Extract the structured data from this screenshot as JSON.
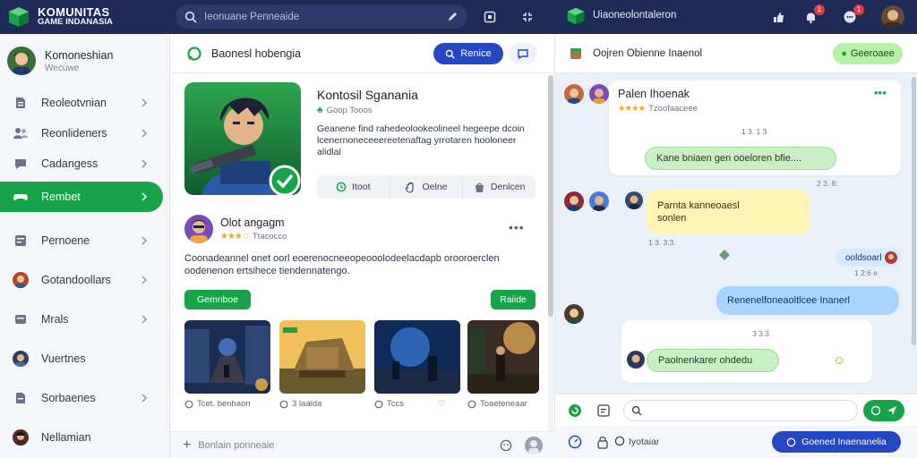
{
  "brand": {
    "line1": "KOMUNITAS",
    "line2": "GAME INDANASIA"
  },
  "search": {
    "placeholder": "Ieonuane Penneaide"
  },
  "topbar_right": {
    "title": "Uiaoneolontaleron",
    "badges": [
      "1",
      "1"
    ]
  },
  "sidebar": {
    "profile": {
      "name": "Komoneshian",
      "sub": "Wecuwe"
    },
    "items": [
      {
        "label": "Reoleotvnian",
        "icon": "document-icon"
      },
      {
        "label": "Reonlideners",
        "icon": "users-icon"
      },
      {
        "label": "Cadangess",
        "icon": "chat-bubble-icon"
      },
      {
        "label": "Rembet",
        "icon": "gamepad-icon",
        "active": true
      },
      {
        "label": "Pernoene",
        "icon": "grid-icon"
      },
      {
        "label": "Gotandoollars",
        "icon": "avatar-icon"
      },
      {
        "label": "Mrals",
        "icon": "card-icon"
      },
      {
        "label": "Vuertnes",
        "icon": "avatar-icon"
      },
      {
        "label": "Sorbaenes",
        "icon": "document-icon"
      },
      {
        "label": "Nellamian",
        "icon": "avatar-icon"
      }
    ]
  },
  "main": {
    "header": {
      "title": "Baonesl hobengia",
      "primary_button": "Renice"
    },
    "game": {
      "title": "Kontosil Sganania",
      "rating_text": "Goop  Tooos",
      "description": "Geanene find rahedeolookeolineel hegeepe dcoin lcenernoneceeereetenaftag yrrotaren hooloneer alidlal",
      "actions": [
        "Itoot",
        "Oelne",
        "Denlcen"
      ]
    },
    "post": {
      "author": "Olot angagm",
      "rating_text": "Ttacocco",
      "text": "Coonadeannel onet oorl eoerenocneeopeooolodeelacdapb orooroerclen oodenenon ertsihece tiendennatengo.",
      "left_button": "Gemnboe",
      "right_button": "Raiide"
    },
    "captions": [
      {
        "text": "Tcet. benhaon",
        "icon": "clock-icon"
      },
      {
        "text": "3 laaida",
        "icon": "heart-icon"
      },
      {
        "text": "Tccs",
        "icon": "clock-icon"
      },
      {
        "text": "Toaeteneaar",
        "icon": "clock-icon"
      }
    ],
    "composer": {
      "placeholder": "Bonlain ponneaie"
    }
  },
  "chat": {
    "header": {
      "title": "Oojren Obienne Inaenol",
      "button": "Geeroaee"
    },
    "card1": {
      "name": "Palen Ihoenak",
      "stars_text": "Tzoofaaceee"
    },
    "time1": "1 3. 1 3.",
    "bubble1": "Kane bniaen gen ooeloren bfie....",
    "time2": "2 3. 8:",
    "bubble2_line1": "Parnta kanneoaesl",
    "bubble2_line2": "sonlen",
    "time3": "1 3. 3.3.",
    "bubble3": "ooldsoarl",
    "bubble3_time": "1 2:6 e",
    "bubble4": "Renenelfoneaoltlcee Inanerl",
    "time4": "3 3.3.",
    "bubble5": "Paolnenkarer ohdedu",
    "input_placeholder": "",
    "footer_label": "Iyotaiar",
    "footer_button": "Goened Inaenanelia"
  },
  "colors": {
    "navy": "#1f2a57",
    "green": "#17a34a",
    "blue": "#2547c4"
  }
}
